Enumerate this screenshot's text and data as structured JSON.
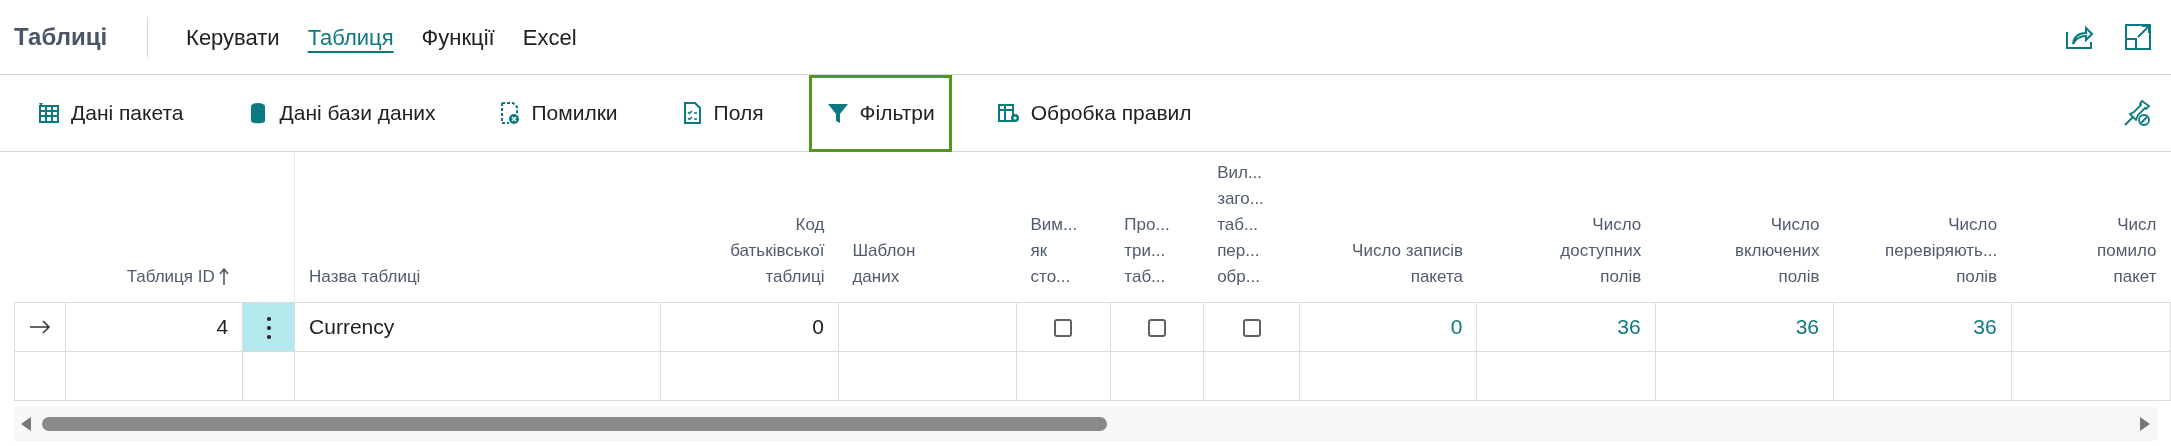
{
  "page": {
    "title": "Таблиці"
  },
  "tabs": [
    {
      "label": "Керувати",
      "selected": false
    },
    {
      "label": "Таблиця",
      "selected": true
    },
    {
      "label": "Функції",
      "selected": false
    },
    {
      "label": "Excel",
      "selected": false
    }
  ],
  "actions": [
    {
      "label": "Дані пакета",
      "focused": false
    },
    {
      "label": "Дані бази даних",
      "focused": false
    },
    {
      "label": "Помилки",
      "focused": false
    },
    {
      "label": "Поля",
      "focused": false
    },
    {
      "label": "Фільтри",
      "focused": true
    },
    {
      "label": "Обробка правил",
      "focused": false
    }
  ],
  "table": {
    "columns": [
      {
        "kind": "marker"
      },
      {
        "kind": "number",
        "lines": [
          "Таблиця ID"
        ],
        "sorted_ascending": true
      },
      {
        "kind": "menu"
      },
      {
        "kind": "text",
        "lines": [
          "Назва таблиці"
        ]
      },
      {
        "kind": "number",
        "lines": [
          "Код",
          "батьківської",
          "таблиці"
        ]
      },
      {
        "kind": "text",
        "lines": [
          "Шаблон",
          "даних"
        ]
      },
      {
        "kind": "checkbox",
        "lines": [
          "Вим...",
          "як",
          "сто..."
        ]
      },
      {
        "kind": "checkbox",
        "lines": [
          "Про...",
          "три...",
          "таб..."
        ]
      },
      {
        "kind": "checkbox",
        "lines": [
          "Вил...",
          "заго...",
          "таб...",
          "пер...",
          "обр..."
        ]
      },
      {
        "kind": "link",
        "lines": [
          "Число записів",
          "пакета"
        ]
      },
      {
        "kind": "link",
        "lines": [
          "Число",
          "доступних",
          "полів"
        ]
      },
      {
        "kind": "link",
        "lines": [
          "Число",
          "включених",
          "полів"
        ]
      },
      {
        "kind": "link",
        "lines": [
          "Число",
          "перевіряють...",
          "полів"
        ]
      },
      {
        "kind": "link",
        "lines": [
          "Числ",
          "помило",
          "пакет"
        ]
      }
    ],
    "rows": [
      {
        "current": true,
        "cells": [
          null,
          "4",
          null,
          "Currency",
          "0",
          null,
          {
            "checked": false
          },
          {
            "checked": false
          },
          {
            "checked": false
          },
          "0",
          "36",
          "36",
          "36",
          null
        ]
      },
      {
        "current": false
      }
    ]
  }
}
